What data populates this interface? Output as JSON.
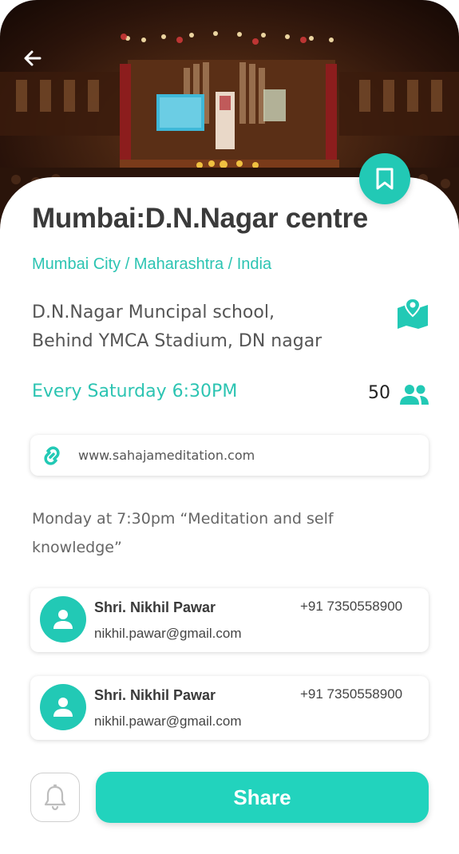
{
  "header": {
    "back_icon": "arrow-left-icon",
    "bookmark_icon": "bookmark-icon"
  },
  "centre": {
    "title": "Mumbai:D.N.Nagar centre",
    "breadcrumb": "Mumbai City / Maharashtra / India",
    "address_line1": "D.N.Nagar Muncipal school,",
    "address_line2": "Behind YMCA Stadium, DN nagar",
    "map_icon": "map-pin-icon",
    "schedule": "Every Saturday 6:30PM",
    "attendee_count": "50",
    "people_icon": "people-icon",
    "website": "www.sahajameditation.com",
    "link_icon": "link-icon",
    "description": "Monday at 7:30pm “Meditation and self knowledge”"
  },
  "contacts": [
    {
      "name": "Shri. Nikhil Pawar",
      "phone": "+91 7350558900",
      "email": "nikhil.pawar@gmail.com"
    },
    {
      "name": "Shri. Nikhil Pawar",
      "phone": "+91 7350558900",
      "email": "nikhil.pawar@gmail.com"
    }
  ],
  "footer": {
    "bell_icon": "bell-icon",
    "share_label": "Share"
  },
  "colors": {
    "accent": "#22c9b5",
    "title": "#3a3a3a",
    "body_text": "#555555"
  }
}
